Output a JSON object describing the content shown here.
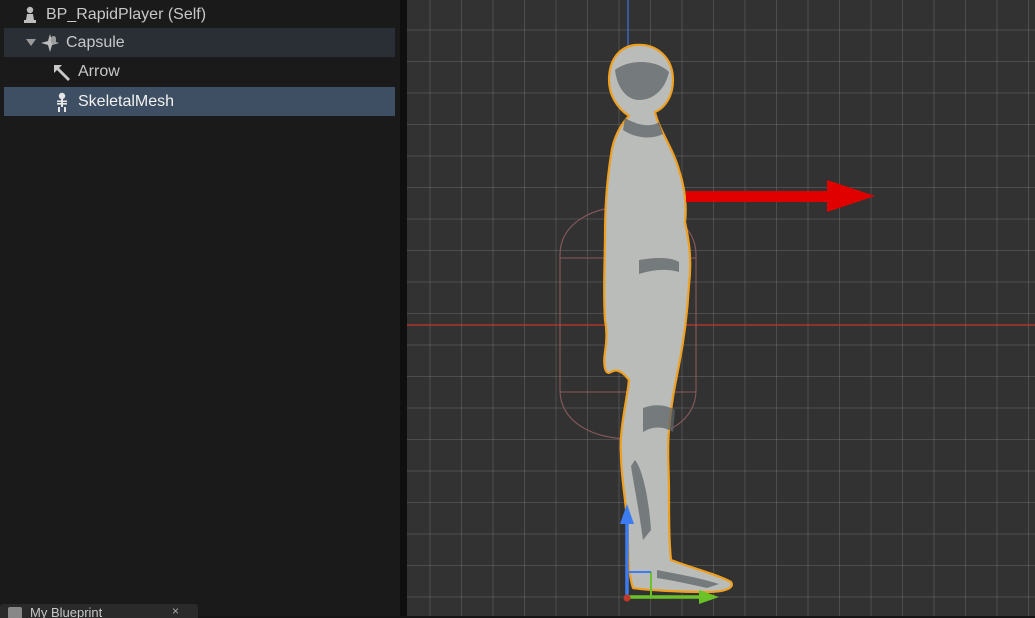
{
  "component_tree": {
    "items": [
      {
        "label": "BP_RapidPlayer (Self)",
        "icon": "pawn-icon"
      },
      {
        "label": "Capsule",
        "icon": "capsule-icon",
        "expanded": true
      },
      {
        "label": "Arrow",
        "icon": "arrow-component-icon"
      },
      {
        "label": "SkeletalMesh",
        "icon": "skeleton-icon",
        "selected": true
      }
    ]
  },
  "bottom_tab": {
    "label": "My Blueprint",
    "close": "×"
  },
  "viewport": {
    "colors": {
      "background": "#323232",
      "x_axis": "#c0392b",
      "z_axis": "#3a6fd8",
      "forward_arrow": "#e00000",
      "selection_outline": "#f0a020",
      "gizmo_green": "#6ac228",
      "gizmo_blue": "#3d7cf0"
    }
  }
}
